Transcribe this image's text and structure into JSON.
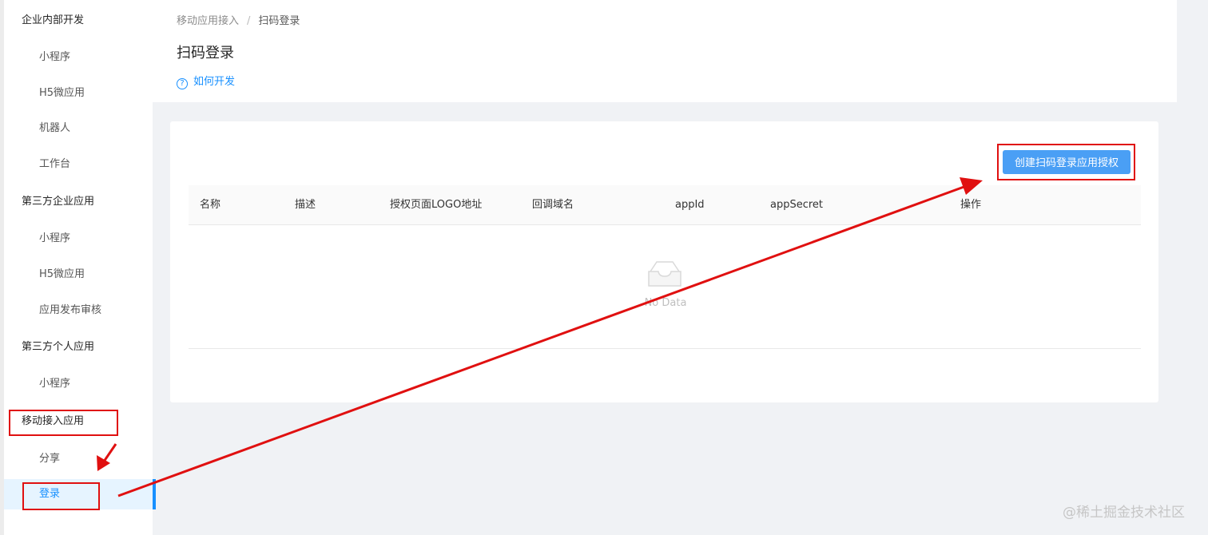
{
  "sidebar": {
    "groups": [
      {
        "label": "企业内部开发",
        "items": [
          "小程序",
          "H5微应用",
          "机器人",
          "工作台"
        ]
      },
      {
        "label": "第三方企业应用",
        "items": [
          "小程序",
          "H5微应用",
          "应用发布审核"
        ]
      },
      {
        "label": "第三方个人应用",
        "items": [
          "小程序"
        ]
      },
      {
        "label": "移动接入应用",
        "items": [
          "分享",
          "登录"
        ]
      }
    ],
    "active_item": "登录"
  },
  "header": {
    "breadcrumb": [
      "移动应用接入",
      "扫码登录"
    ],
    "breadcrumb_separator": "/",
    "title": "扫码登录",
    "help_link": "如何开发",
    "help_icon": "question-circle-icon"
  },
  "card": {
    "create_button": "创建扫码登录应用授权",
    "columns": [
      "名称",
      "描述",
      "授权页面LOGO地址",
      "回调域名",
      "appId",
      "appSecret",
      "操作"
    ],
    "rows": [],
    "empty_text": "No Data",
    "empty_icon": "inbox-icon"
  },
  "watermark": "@稀土掘金技术社区",
  "colors": {
    "accent": "#1890ff",
    "button": "#4a9ff5",
    "annotation": "#e01010"
  }
}
